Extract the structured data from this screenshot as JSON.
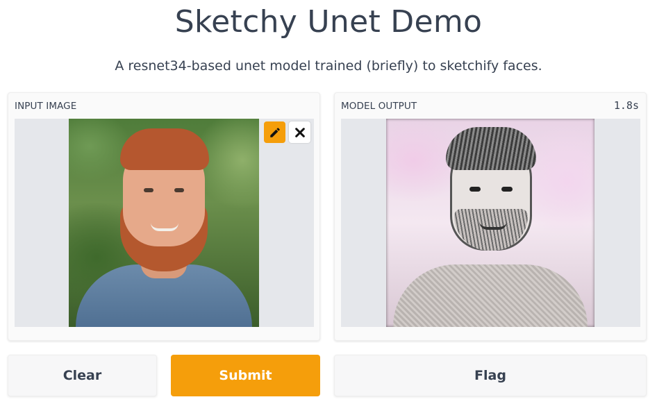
{
  "header": {
    "title": "Sketchy Unet Demo",
    "description": "A resnet34-based unet model trained (briefly) to sketchify faces."
  },
  "input_panel": {
    "label": "INPUT IMAGE",
    "edit_icon": "pencil-icon",
    "remove_icon": "close-icon"
  },
  "output_panel": {
    "label": "MODEL OUTPUT",
    "timing": "1.8s"
  },
  "buttons": {
    "clear": "Clear",
    "submit": "Submit",
    "flag": "Flag"
  },
  "colors": {
    "accent": "#f59e0b",
    "text": "#374151",
    "panel_bg": "#fafafa",
    "image_bg": "#e5e7eb"
  }
}
